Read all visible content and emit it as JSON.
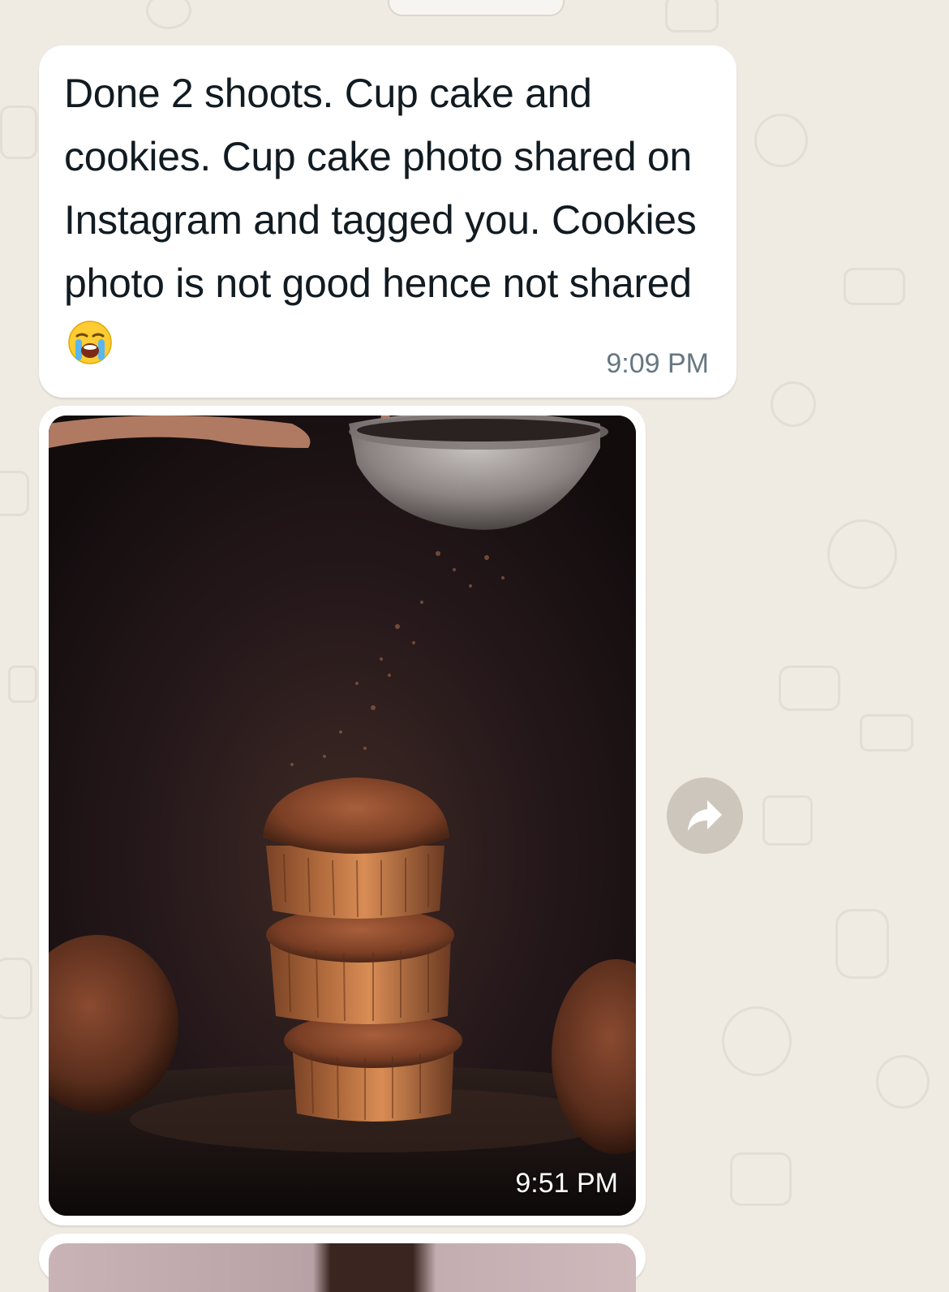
{
  "chat": {
    "messages": [
      {
        "type": "text",
        "text": "Done 2 shoots. Cup cake and cookies. Cup cake photo shared on Instagram and tagged you. Cookies photo is not good hence not shared",
        "emoji": "loudly-crying-face",
        "time": "9:09 PM"
      },
      {
        "type": "image",
        "image_subject": "stacked cupcakes dusted with cocoa powder from a sieve",
        "time": "9:51 PM"
      }
    ]
  },
  "icons": {
    "forward": "forward-arrow-icon"
  },
  "colors": {
    "chat_background": "#efeae2",
    "bubble": "#ffffff",
    "text": "#111b21",
    "timestamp": "#667781",
    "forward_button": "#cdc6bc"
  }
}
